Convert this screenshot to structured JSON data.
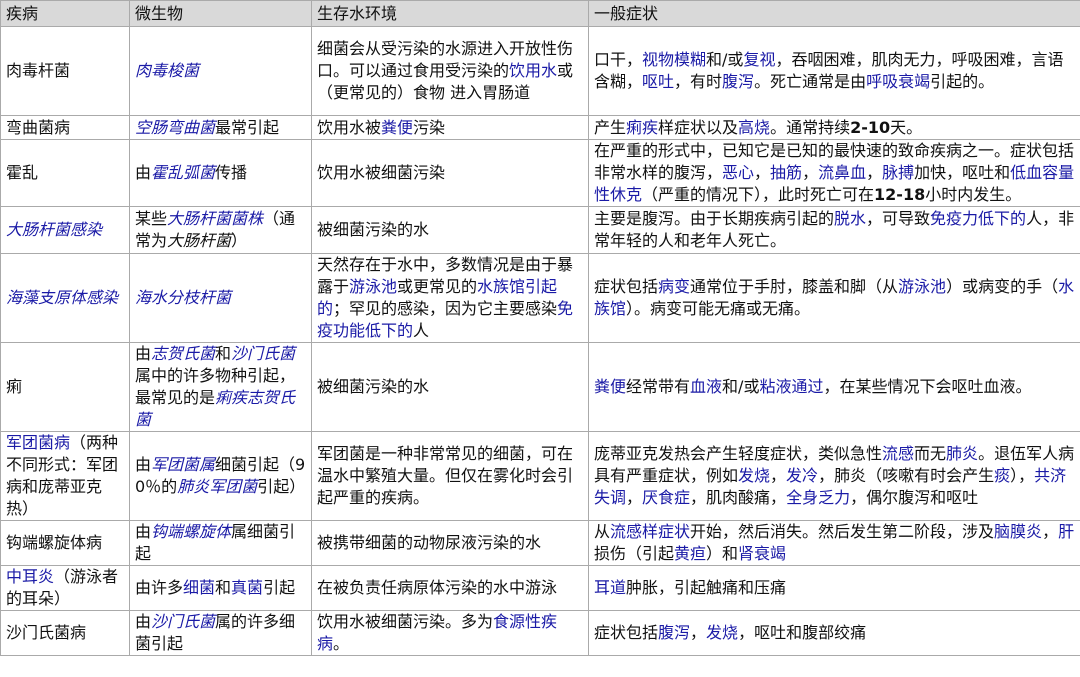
{
  "table": {
    "headers": [
      "疾病",
      "微生物",
      "生存水环境",
      "一般症状"
    ],
    "rows": [
      {
        "disease": [
          {
            "t": "肉毒杆菌"
          }
        ],
        "organism": [
          {
            "t": "肉毒梭菌",
            "s": "lkit"
          }
        ],
        "environment": [
          {
            "t": "细菌会从受污染的水源进入开放性伤口。可以通过食用受污染的"
          },
          {
            "t": "饮用水",
            "s": "lk"
          },
          {
            "t": "或（更常见的）食物 进入胃肠道"
          }
        ],
        "symptoms": [
          {
            "t": "口干，"
          },
          {
            "t": "视物模糊",
            "s": "lk"
          },
          {
            "t": "和/或"
          },
          {
            "t": "复视",
            "s": "lk"
          },
          {
            "t": "，吞咽困难，肌肉无力，呼吸困难，言语含糊，"
          },
          {
            "t": "呕吐",
            "s": "lk"
          },
          {
            "t": "，有时"
          },
          {
            "t": "腹泻",
            "s": "lk"
          },
          {
            "t": "。死亡通常是由"
          },
          {
            "t": "呼吸衰竭",
            "s": "lk"
          },
          {
            "t": "引起的。"
          }
        ]
      },
      {
        "disease": [
          {
            "t": "弯曲菌病"
          }
        ],
        "organism": [
          {
            "t": "空肠弯曲菌",
            "s": "lkit"
          },
          {
            "t": "最常引起"
          }
        ],
        "environment": [
          {
            "t": "饮用水被"
          },
          {
            "t": "粪便",
            "s": "lk"
          },
          {
            "t": "污染"
          }
        ],
        "symptoms": [
          {
            "t": "产生"
          },
          {
            "t": "痢疾",
            "s": "lk"
          },
          {
            "t": "样症状以及"
          },
          {
            "t": "高烧",
            "s": "lk"
          },
          {
            "t": "。通常持续"
          },
          {
            "t": "2-10",
            "s": "num"
          },
          {
            "t": "天。"
          }
        ]
      },
      {
        "disease": [
          {
            "t": "霍乱"
          }
        ],
        "organism": [
          {
            "t": "由"
          },
          {
            "t": "霍乱弧菌",
            "s": "lkit"
          },
          {
            "t": "传播"
          }
        ],
        "environment": [
          {
            "t": "饮用水被细菌污染"
          }
        ],
        "symptoms": [
          {
            "t": "在严重的形式中，已知它是已知的最快速的致命疾病之一。症状包括非常水样的腹泻，"
          },
          {
            "t": "恶心",
            "s": "lk"
          },
          {
            "t": "，"
          },
          {
            "t": "抽筋",
            "s": "lk"
          },
          {
            "t": "，"
          },
          {
            "t": "流鼻血",
            "s": "lk"
          },
          {
            "t": "，"
          },
          {
            "t": "脉搏",
            "s": "lk"
          },
          {
            "t": "加快，呕吐和"
          },
          {
            "t": "低血容量性休克",
            "s": "lk"
          },
          {
            "t": "（严重的情况下），此时死亡可在"
          },
          {
            "t": "12-18",
            "s": "num"
          },
          {
            "t": "小时内发生。"
          }
        ]
      },
      {
        "disease": [
          {
            "t": "大肠杆菌感染",
            "s": "lkit"
          }
        ],
        "organism": [
          {
            "t": "某些"
          },
          {
            "t": "大肠杆菌菌株",
            "s": "lkit"
          },
          {
            "t": "（通常为"
          },
          {
            "t": "大肠杆菌",
            "s": "it"
          },
          {
            "t": "）"
          }
        ],
        "environment": [
          {
            "t": "被细菌污染的水"
          }
        ],
        "symptoms": [
          {
            "t": "主要是腹泻。由于长期疾病引起的"
          },
          {
            "t": "脱水",
            "s": "lk"
          },
          {
            "t": "，可导致"
          },
          {
            "t": "免疫力低下的",
            "s": "lk"
          },
          {
            "t": "人，非常年轻的人和老年人死亡。"
          }
        ]
      },
      {
        "disease": [
          {
            "t": "海藻支原体感染",
            "s": "lkit"
          }
        ],
        "organism": [
          {
            "t": "海水分枝杆菌",
            "s": "lkit"
          }
        ],
        "environment": [
          {
            "t": "天然存在于水中，多数情况是由于暴露于"
          },
          {
            "t": "游泳池",
            "s": "lk"
          },
          {
            "t": "或更常见的"
          },
          {
            "t": "水族馆引起的",
            "s": "lk"
          },
          {
            "t": "；罕见的感染，因为它主要感染"
          },
          {
            "t": "免疫功能低下的",
            "s": "lk"
          },
          {
            "t": "人"
          }
        ],
        "symptoms": [
          {
            "t": "症状包括"
          },
          {
            "t": "病变",
            "s": "lk"
          },
          {
            "t": "通常位于手肘，膝盖和脚（从"
          },
          {
            "t": "游泳池",
            "s": "lk"
          },
          {
            "t": "）或病变的手（"
          },
          {
            "t": "水族馆",
            "s": "lk"
          },
          {
            "t": "）。病变可能无痛或无痛。"
          }
        ]
      },
      {
        "disease": [
          {
            "t": "痢"
          }
        ],
        "organism": [
          {
            "t": "由"
          },
          {
            "t": "志贺氏菌",
            "s": "lkit"
          },
          {
            "t": "和"
          },
          {
            "t": "沙门氏菌",
            "s": "lkit"
          },
          {
            "t": "属中的许多物种引起，最常见的是"
          },
          {
            "t": "痢疾志贺氏菌",
            "s": "lkit"
          }
        ],
        "environment": [
          {
            "t": "被细菌污染的水"
          }
        ],
        "symptoms": [
          {
            "t": "粪便",
            "s": "lk"
          },
          {
            "t": "经常带有"
          },
          {
            "t": "血液",
            "s": "lk"
          },
          {
            "t": "和/或"
          },
          {
            "t": "粘液通过",
            "s": "lk"
          },
          {
            "t": "，在某些情况下会呕吐血液。"
          }
        ]
      },
      {
        "disease": [
          {
            "t": "军团菌病",
            "s": "lk"
          },
          {
            "t": "（两种不同形式：军团病和庞蒂亚克热）"
          }
        ],
        "organism": [
          {
            "t": "由"
          },
          {
            "t": "军团菌属",
            "s": "lkit"
          },
          {
            "t": "细菌引起（90％的"
          },
          {
            "t": "肺炎军团菌",
            "s": "lkit"
          },
          {
            "t": "引起）"
          }
        ],
        "environment": [
          {
            "t": "军团菌是一种非常常见的细菌，可在温水中繁殖大量。但仅在雾化时会引起严重的疾病。"
          }
        ],
        "symptoms": [
          {
            "t": "庞蒂亚克发热会产生轻度症状，类似急性"
          },
          {
            "t": "流感",
            "s": "lk"
          },
          {
            "t": "而无"
          },
          {
            "t": "肺炎",
            "s": "lk"
          },
          {
            "t": "。退伍军人病具有严重症状，例如"
          },
          {
            "t": "发烧",
            "s": "lk"
          },
          {
            "t": "，"
          },
          {
            "t": "发冷",
            "s": "lk"
          },
          {
            "t": "，肺炎（咳嗽有时会产生"
          },
          {
            "t": "痰",
            "s": "lk"
          },
          {
            "t": "），"
          },
          {
            "t": "共济失调",
            "s": "lk"
          },
          {
            "t": "，"
          },
          {
            "t": "厌食症",
            "s": "lk"
          },
          {
            "t": "，肌肉酸痛，"
          },
          {
            "t": "全身乏力",
            "s": "lk"
          },
          {
            "t": "，偶尔腹泻和呕吐"
          }
        ]
      },
      {
        "disease": [
          {
            "t": "钩端螺旋体病"
          }
        ],
        "organism": [
          {
            "t": "由"
          },
          {
            "t": "钩端螺旋体",
            "s": "lkit"
          },
          {
            "t": "属细菌引起"
          }
        ],
        "environment": [
          {
            "t": "被携带细菌的动物尿液污染的水"
          }
        ],
        "symptoms": [
          {
            "t": "从"
          },
          {
            "t": "流感样症状",
            "s": "lk"
          },
          {
            "t": "开始，然后消失。然后发生第二阶段，涉及"
          },
          {
            "t": "脑膜炎",
            "s": "lk"
          },
          {
            "t": "，"
          },
          {
            "t": "肝",
            "s": "lk"
          },
          {
            "t": "损伤（引起"
          },
          {
            "t": "黄疸",
            "s": "lk"
          },
          {
            "t": "）和"
          },
          {
            "t": "肾衰竭",
            "s": "lk"
          }
        ]
      },
      {
        "disease": [
          {
            "t": "中耳炎",
            "s": "lk"
          },
          {
            "t": "（游泳者的耳朵）"
          }
        ],
        "organism": [
          {
            "t": "由许多"
          },
          {
            "t": "细菌",
            "s": "lk"
          },
          {
            "t": "和"
          },
          {
            "t": "真菌",
            "s": "lk"
          },
          {
            "t": "引起"
          }
        ],
        "environment": [
          {
            "t": "在被负责任病原体污染的水中游泳"
          }
        ],
        "symptoms": [
          {
            "t": "耳道",
            "s": "lk"
          },
          {
            "t": "肿胀，引起触痛和压痛"
          }
        ]
      },
      {
        "disease": [
          {
            "t": "沙门氏菌病"
          }
        ],
        "organism": [
          {
            "t": "由"
          },
          {
            "t": "沙门氏菌",
            "s": "lkit"
          },
          {
            "t": "属的许多细菌引起"
          }
        ],
        "environment": [
          {
            "t": "饮用水被细菌污染。多为"
          },
          {
            "t": "食源性疾病",
            "s": "lk"
          },
          {
            "t": "。"
          }
        ],
        "symptoms": [
          {
            "t": "症状包括"
          },
          {
            "t": "腹泻",
            "s": "lk"
          },
          {
            "t": "，"
          },
          {
            "t": "发烧",
            "s": "lk"
          },
          {
            "t": "，呕吐和腹部绞痛"
          }
        ]
      }
    ]
  }
}
